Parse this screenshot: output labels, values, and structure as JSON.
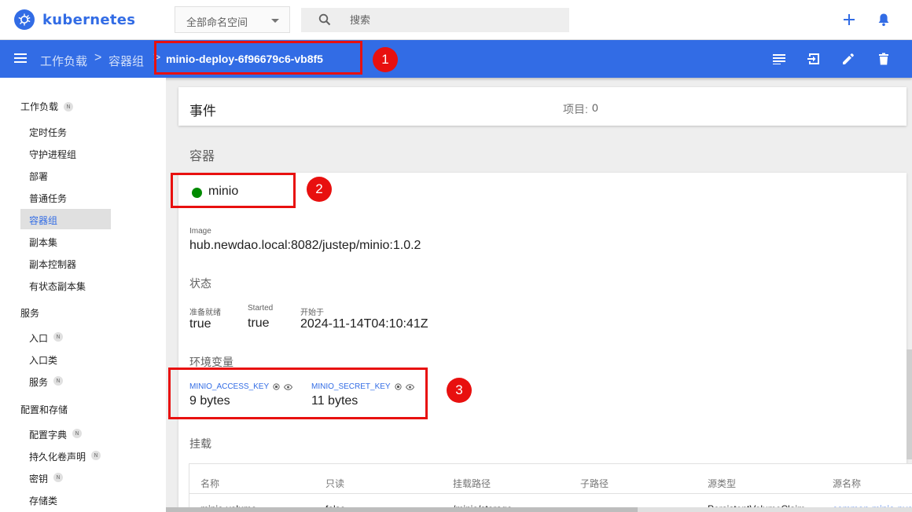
{
  "app": {
    "name": "kubernetes"
  },
  "header": {
    "namespace": "全部命名空间",
    "search_placeholder": "搜索"
  },
  "breadcrumb": {
    "items": [
      "工作负载",
      "容器组"
    ],
    "separator": ">",
    "current": "minio-deploy-6f96679c6-vb8f5"
  },
  "sidebar": {
    "sections": [
      {
        "label": "工作负载",
        "badge": "N"
      },
      {
        "label": "服务",
        "badge": ""
      },
      {
        "label": "配置和存储",
        "badge": ""
      }
    ],
    "workloads": [
      {
        "label": "定时任务",
        "badge": ""
      },
      {
        "label": "守护进程组",
        "badge": ""
      },
      {
        "label": "部署",
        "badge": ""
      },
      {
        "label": "普通任务",
        "badge": ""
      },
      {
        "label": "容器组",
        "badge": "",
        "active": true
      },
      {
        "label": "副本集",
        "badge": ""
      },
      {
        "label": "副本控制器",
        "badge": ""
      },
      {
        "label": "有状态副本集",
        "badge": ""
      }
    ],
    "services": [
      {
        "label": "入口",
        "badge": "N"
      },
      {
        "label": "入口类",
        "badge": ""
      },
      {
        "label": "服务",
        "badge": "N"
      }
    ],
    "config": [
      {
        "label": "配置字典",
        "badge": "N"
      },
      {
        "label": "持久化卷声明",
        "badge": "N"
      },
      {
        "label": "密钥",
        "badge": "N"
      },
      {
        "label": "存储类",
        "badge": ""
      }
    ]
  },
  "events": {
    "title": "事件",
    "count_label": "项目:",
    "count": "0"
  },
  "containers": {
    "title": "容器",
    "name": "minio",
    "image_label": "Image",
    "image": "hub.newdao.local:8082/justep/minio:1.0.2",
    "status_title": "状态",
    "status": [
      {
        "label": "准备就绪",
        "value": "true"
      },
      {
        "label": "Started",
        "value": "true"
      },
      {
        "label": "开始于",
        "value": "2024-11-14T04:10:41Z"
      }
    ],
    "env_title": "环境变量",
    "env": [
      {
        "key": "MINIO_ACCESS_KEY",
        "value": "9 bytes"
      },
      {
        "key": "MINIO_SECRET_KEY",
        "value": "11 bytes"
      }
    ],
    "mounts_title": "挂载",
    "mount_headers": [
      "名称",
      "只读",
      "挂载路径",
      "子路径",
      "源类型",
      "源名称"
    ],
    "mount_row": [
      "minio-volume",
      "false",
      "/minio/storage",
      "",
      "PersistentVolumeClaim",
      "common-minio-pvc"
    ]
  },
  "annotations": [
    "1",
    "2",
    "3"
  ],
  "colors": {
    "brand": "#326ce5",
    "annotation": "#e8100f",
    "status_ok": "#008a00"
  }
}
